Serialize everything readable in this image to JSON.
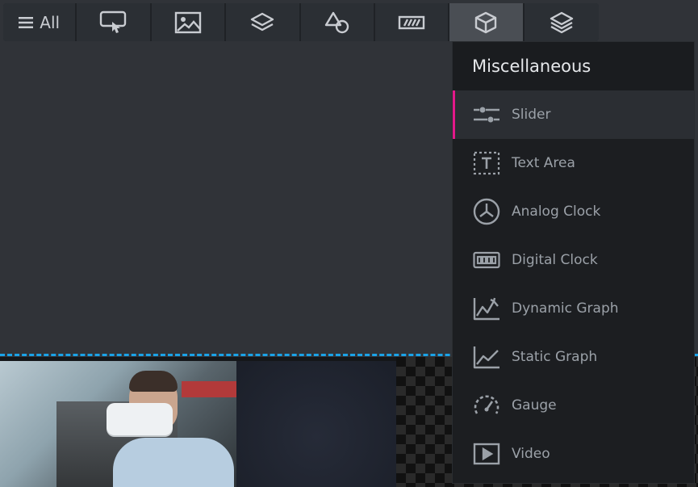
{
  "toolbar": {
    "all_label": "All",
    "buttons": [
      {
        "icon": "touch-screen-icon"
      },
      {
        "icon": "image-icon"
      },
      {
        "icon": "layers-icon"
      },
      {
        "icon": "shapes-icon"
      },
      {
        "icon": "ticker-bar-icon"
      },
      {
        "icon": "cube-icon",
        "active": true
      },
      {
        "icon": "stack-icon"
      }
    ]
  },
  "panel": {
    "title": "Miscellaneous",
    "items": [
      {
        "label": "Slider",
        "icon": "slider-icon",
        "active": true
      },
      {
        "label": "Text Area",
        "icon": "text-area-icon"
      },
      {
        "label": "Analog Clock",
        "icon": "analog-clock-icon"
      },
      {
        "label": "Digital Clock",
        "icon": "digital-clock-icon"
      },
      {
        "label": "Dynamic Graph",
        "icon": "dynamic-graph-icon"
      },
      {
        "label": "Static Graph",
        "icon": "static-graph-icon"
      },
      {
        "label": "Gauge",
        "icon": "gauge-icon"
      },
      {
        "label": "Video",
        "icon": "video-icon"
      }
    ]
  },
  "colors": {
    "accent": "#e3188a",
    "guide": "#1aa3e8",
    "panel_bg": "#1c1e21",
    "canvas_bg": "#303338"
  }
}
